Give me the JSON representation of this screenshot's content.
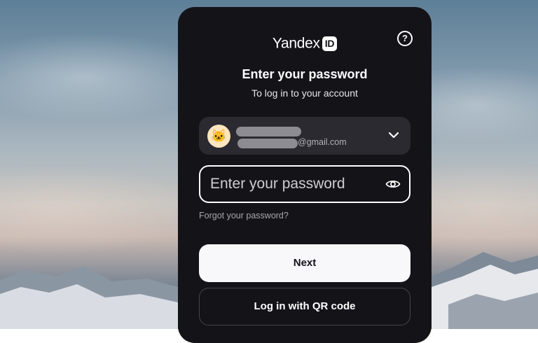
{
  "brand": {
    "name": "Yandex",
    "badge": "ID"
  },
  "header": {
    "help_icon": "question-circle-icon",
    "help_glyph": "?"
  },
  "form": {
    "title": "Enter your password",
    "subtitle": "To log in to your account",
    "account": {
      "avatar_icon": "cat-face-icon",
      "avatar_glyph": "🐱",
      "email_domain": "@gmail.com",
      "expand_icon": "chevron-down-icon"
    },
    "password": {
      "placeholder": "Enter your password",
      "value": "",
      "toggle_icon": "eye-icon"
    },
    "forgot_label": "Forgot your password?",
    "next_label": "Next",
    "qr_label": "Log in with QR code"
  },
  "colors": {
    "card_bg": "#141318",
    "account_bg": "#2b2a31",
    "primary_button_bg": "#f8f8fb",
    "avatar_bg": "#fbe6bd"
  }
}
